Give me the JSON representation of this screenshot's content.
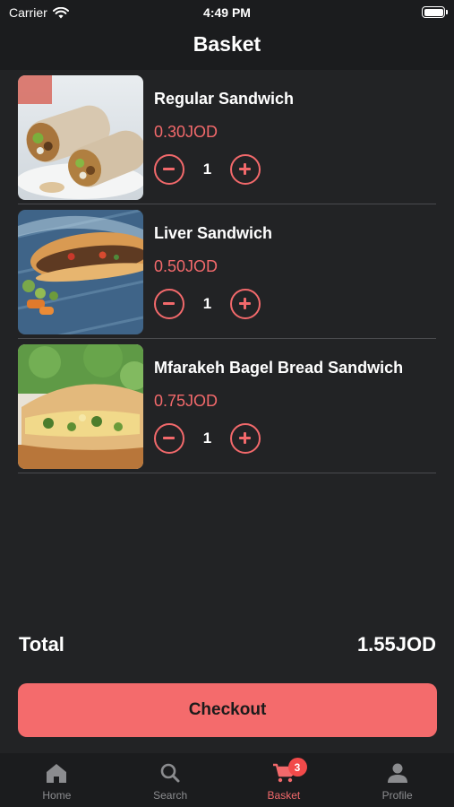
{
  "status_bar": {
    "carrier": "Carrier",
    "time": "4:49 PM"
  },
  "header": {
    "title": "Basket"
  },
  "items": [
    {
      "name": "Regular Sandwich",
      "price": "0.30JOD",
      "quantity": "1"
    },
    {
      "name": "Liver Sandwich",
      "price": "0.50JOD",
      "quantity": "1"
    },
    {
      "name": "Mfarakeh Bagel Bread Sandwich",
      "price": "0.75JOD",
      "quantity": "1"
    }
  ],
  "summary": {
    "total_label": "Total",
    "total_value": "1.55JOD"
  },
  "checkout": {
    "label": "Checkout"
  },
  "tabbar": {
    "tabs": [
      {
        "label": "Home",
        "icon": "home-icon"
      },
      {
        "label": "Search",
        "icon": "search-icon"
      },
      {
        "label": "Basket",
        "icon": "cart-icon",
        "badge": "3",
        "active": true
      },
      {
        "label": "Profile",
        "icon": "profile-icon"
      }
    ]
  },
  "colors": {
    "accent": "#f46b6c",
    "background": "#222325",
    "bar": "#1b1c1e"
  }
}
